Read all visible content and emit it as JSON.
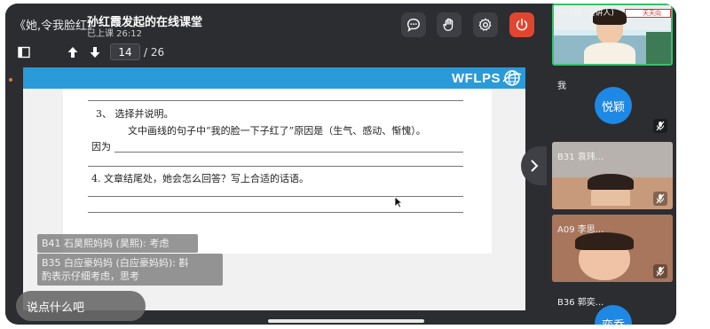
{
  "topbar": {
    "back_title": "《她,令我脸红》",
    "meeting_title": "孙红霞发起的在线课堂",
    "meeting_time": "已上课 26:12"
  },
  "toolbar": {
    "current_page": "14",
    "total_pages": "/ 26"
  },
  "slide": {
    "logo_text": "WFLPS",
    "q3_label": "3、  选择并说明。",
    "q3_body": "文中画线的句子中“我的脸一下子红了”原因是（生气、感动、惭愧）。",
    "q3_because": "因为",
    "q4_label": "4. 文章结尾处，她会怎么回答？写上合适的话语。"
  },
  "chat": {
    "messages": [
      "B41 石昊熙妈妈 (昊熙): 考虑",
      "B35 白应豪妈妈 (白应豪妈妈): 斟",
      "酌表示仔细考虑，思考"
    ],
    "input_placeholder": "说点什么吧"
  },
  "participants": {
    "host_label": "孙红霞 (主讲人)",
    "host_classroom_sign": "天天向",
    "me_label": "我",
    "me_avatar": "悦颖",
    "p1_label": "B31 袁玮...",
    "p2_label": "A09 李思...",
    "p3_label": "B36 郭奕...",
    "p3_avatar": "奕乔"
  },
  "colors": {
    "app_bg": "#2b2d31",
    "slide_header": "#2a9ad8",
    "avatar_blue": "#1e88e5",
    "hangup_red": "#e2452f"
  }
}
